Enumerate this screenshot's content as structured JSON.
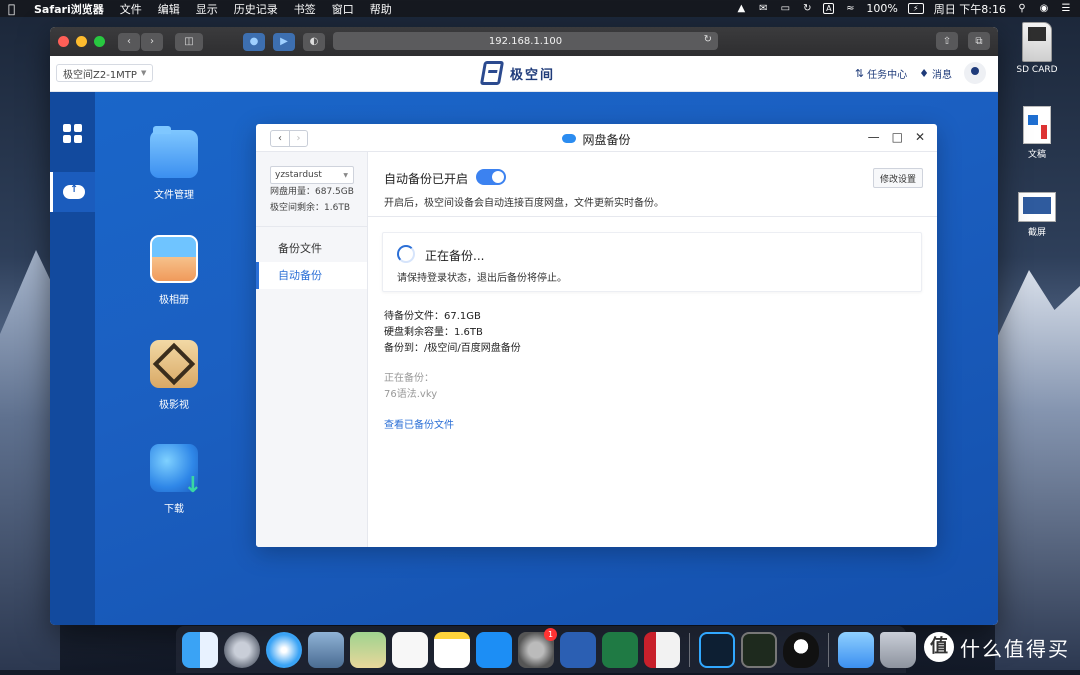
{
  "menubar": {
    "app_name": "Safari浏览器",
    "items": [
      "文件",
      "编辑",
      "显示",
      "历史记录",
      "书签",
      "窗口",
      "帮助"
    ],
    "battery": "100%",
    "clock": "周日 下午8:16"
  },
  "desktop": {
    "icons": [
      {
        "label": "SD CARD"
      },
      {
        "label": "文稿"
      },
      {
        "label": "截屏"
      }
    ]
  },
  "browser": {
    "address": "192.168.1.100"
  },
  "app": {
    "device": "极空间Z2-1MTP",
    "brand": "极空间",
    "task_center": "任务中心",
    "messages": "消息",
    "launcher": [
      {
        "label": "文件管理"
      },
      {
        "label": "极相册"
      },
      {
        "label": "极影视"
      },
      {
        "label": "下载"
      }
    ]
  },
  "dialog": {
    "title": "网盘备份",
    "account": "yzstardust",
    "usage_label": "网盘用量：",
    "usage_value": "687.5GB",
    "free_label": "极空间剩余：",
    "free_value": "1.6TB",
    "nav": [
      {
        "label": "备份文件",
        "active": false
      },
      {
        "label": "自动备份",
        "active": true
      }
    ],
    "auto_backup_status": "自动备份已开启",
    "auto_backup_enabled": true,
    "auto_backup_desc": "开启后，极空间设备会自动连接百度网盘，文件更新实时备份。",
    "edit_settings": "修改设置",
    "progress_title": "正在备份...",
    "progress_desc": "请保持登录状态，退出后备份将停止。",
    "pending_files": "待备份文件：67.1GB",
    "disk_free": "硬盘剩余容量：1.6TB",
    "backup_to": "备份到：/极空间/百度网盘备份",
    "current_label": "正在备份：",
    "current_file": "76语法.vky",
    "view_link": "查看已备份文件"
  },
  "dock": {
    "notification_badge": "1"
  },
  "watermark": {
    "circle": "值",
    "text": "什么值得买"
  }
}
